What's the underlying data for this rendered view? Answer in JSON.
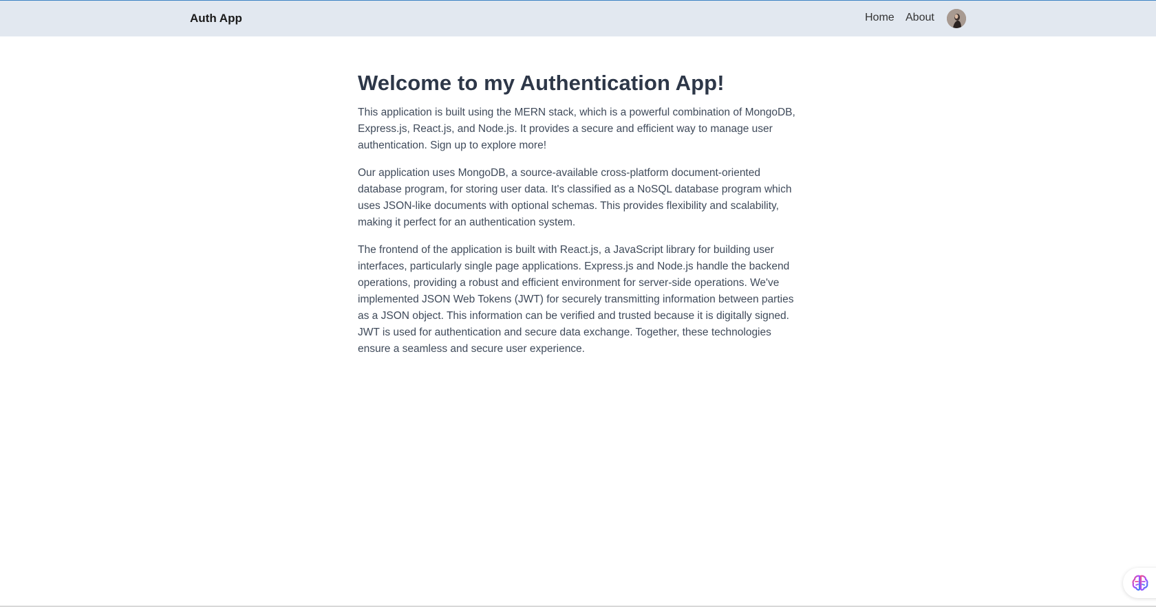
{
  "header": {
    "brand": "Auth App",
    "nav": {
      "home": "Home",
      "about": "About"
    },
    "avatar_icon": "user-avatar"
  },
  "main": {
    "title": "Welcome to my Authentication App!",
    "paragraphs": [
      "This application is built using the MERN stack, which is a powerful combination of MongoDB, Express.js, React.js, and Node.js. It provides a secure and efficient way to manage user authentication. Sign up to explore more!",
      "Our application uses MongoDB, a source-available cross-platform document-oriented database program, for storing user data. It's classified as a NoSQL database program which uses JSON-like documents with optional schemas. This provides flexibility and scalability, making it perfect for an authentication system.",
      "The frontend of the application is built with React.js, a JavaScript library for building user interfaces, particularly single page applications. Express.js and Node.js handle the backend operations, providing a robust and efficient environment for server-side operations. We've implemented JSON Web Tokens (JWT) for securely transmitting information between parties as a JSON object. This information can be verified and trusted because it is digitally signed. JWT is used for authentication and secure data exchange. Together, these technologies ensure a seamless and secure user experience."
    ]
  },
  "widget": {
    "icon": "brain-icon"
  },
  "colors": {
    "header_bg": "#e2e8f0",
    "title": "#2d3748",
    "body_text": "#3f4a5a"
  }
}
